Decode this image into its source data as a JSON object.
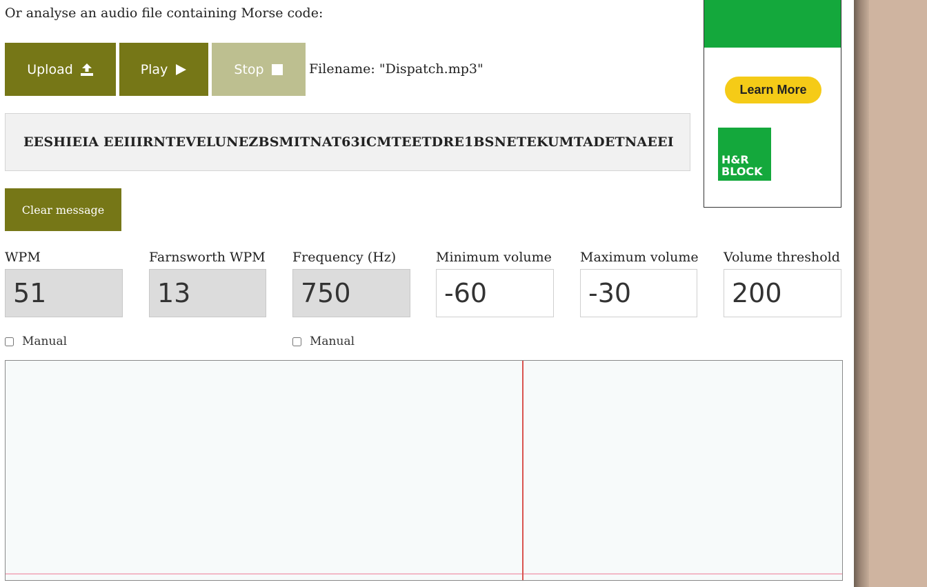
{
  "intro_text": "Or analyse an audio file containing Morse code:",
  "buttons": {
    "upload": "Upload",
    "play": "Play",
    "stop": "Stop",
    "clear": "Clear message"
  },
  "filename": "Filename: \"Dispatch.mp3\"",
  "decoded_message": "EESHIEIA EEIIIRNTEVELUNEZBSMITNAT63ICMTEETDRE1BSNETEKUMTADETNAEEI",
  "fields": [
    {
      "label": "WPM",
      "value": "51",
      "readonly": true
    },
    {
      "label": "Farnsworth WPM",
      "value": "13",
      "readonly": true
    },
    {
      "label": "Frequency (Hz)",
      "value": "750",
      "readonly": true
    },
    {
      "label": "Minimum volume",
      "value": "-60",
      "readonly": false
    },
    {
      "label": "Maximum volume",
      "value": "-30",
      "readonly": false
    },
    {
      "label": "Volume threshold",
      "value": "200",
      "readonly": false
    }
  ],
  "checkboxes": [
    {
      "label": "Manual",
      "checked": false
    },
    {
      "label": "Manual",
      "checked": false
    }
  ],
  "ad": {
    "cta": "Learn More",
    "logo_line1": "H&R",
    "logo_line2": "BLOCK",
    "brand_color": "#14a83c",
    "cta_color": "#f5cb17"
  },
  "colors": {
    "button_primary": "#767717",
    "button_disabled": "#bdbf90",
    "scope_marker": "#d9534f",
    "scope_baseline": "#f2b8c6",
    "page_side_bg": "#cfb4a0"
  },
  "icons": {
    "upload": "upload-icon",
    "play": "play-icon",
    "stop": "stop-icon"
  }
}
